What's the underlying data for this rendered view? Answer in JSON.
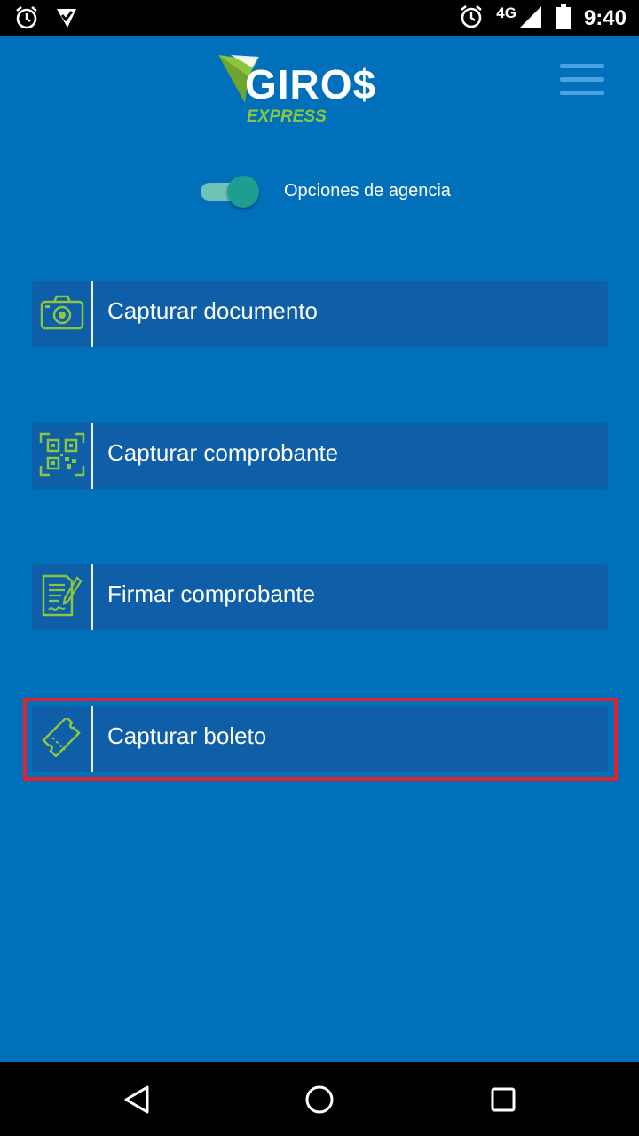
{
  "status_bar": {
    "network": "4G",
    "time": "9:40",
    "icons": [
      "alarm-icon",
      "store-icon",
      "alarm-icon",
      "signal-icon",
      "battery-icon"
    ]
  },
  "header": {
    "logo_main": "GIRO$",
    "logo_sub": "EXPRESS",
    "menu_icon": "hamburger-icon"
  },
  "agency_toggle": {
    "label": "Opciones de agencia",
    "on": true
  },
  "menu": {
    "items": [
      {
        "label": "Capturar documento",
        "icon": "camera-icon"
      },
      {
        "label": "Capturar comprobante",
        "icon": "qr-scan-icon"
      },
      {
        "label": "Firmar comprobante",
        "icon": "sign-document-icon"
      },
      {
        "label": "Capturar boleto",
        "icon": "ticket-icon"
      }
    ]
  },
  "nav_bar": {
    "buttons": [
      "back-icon",
      "home-icon",
      "recents-icon"
    ]
  },
  "colors": {
    "background": "#0070bb",
    "button": "#0f5ea8",
    "accent_green": "#8cc63f",
    "toggle_thumb": "#1e9e90",
    "highlight": "#e0232c"
  }
}
